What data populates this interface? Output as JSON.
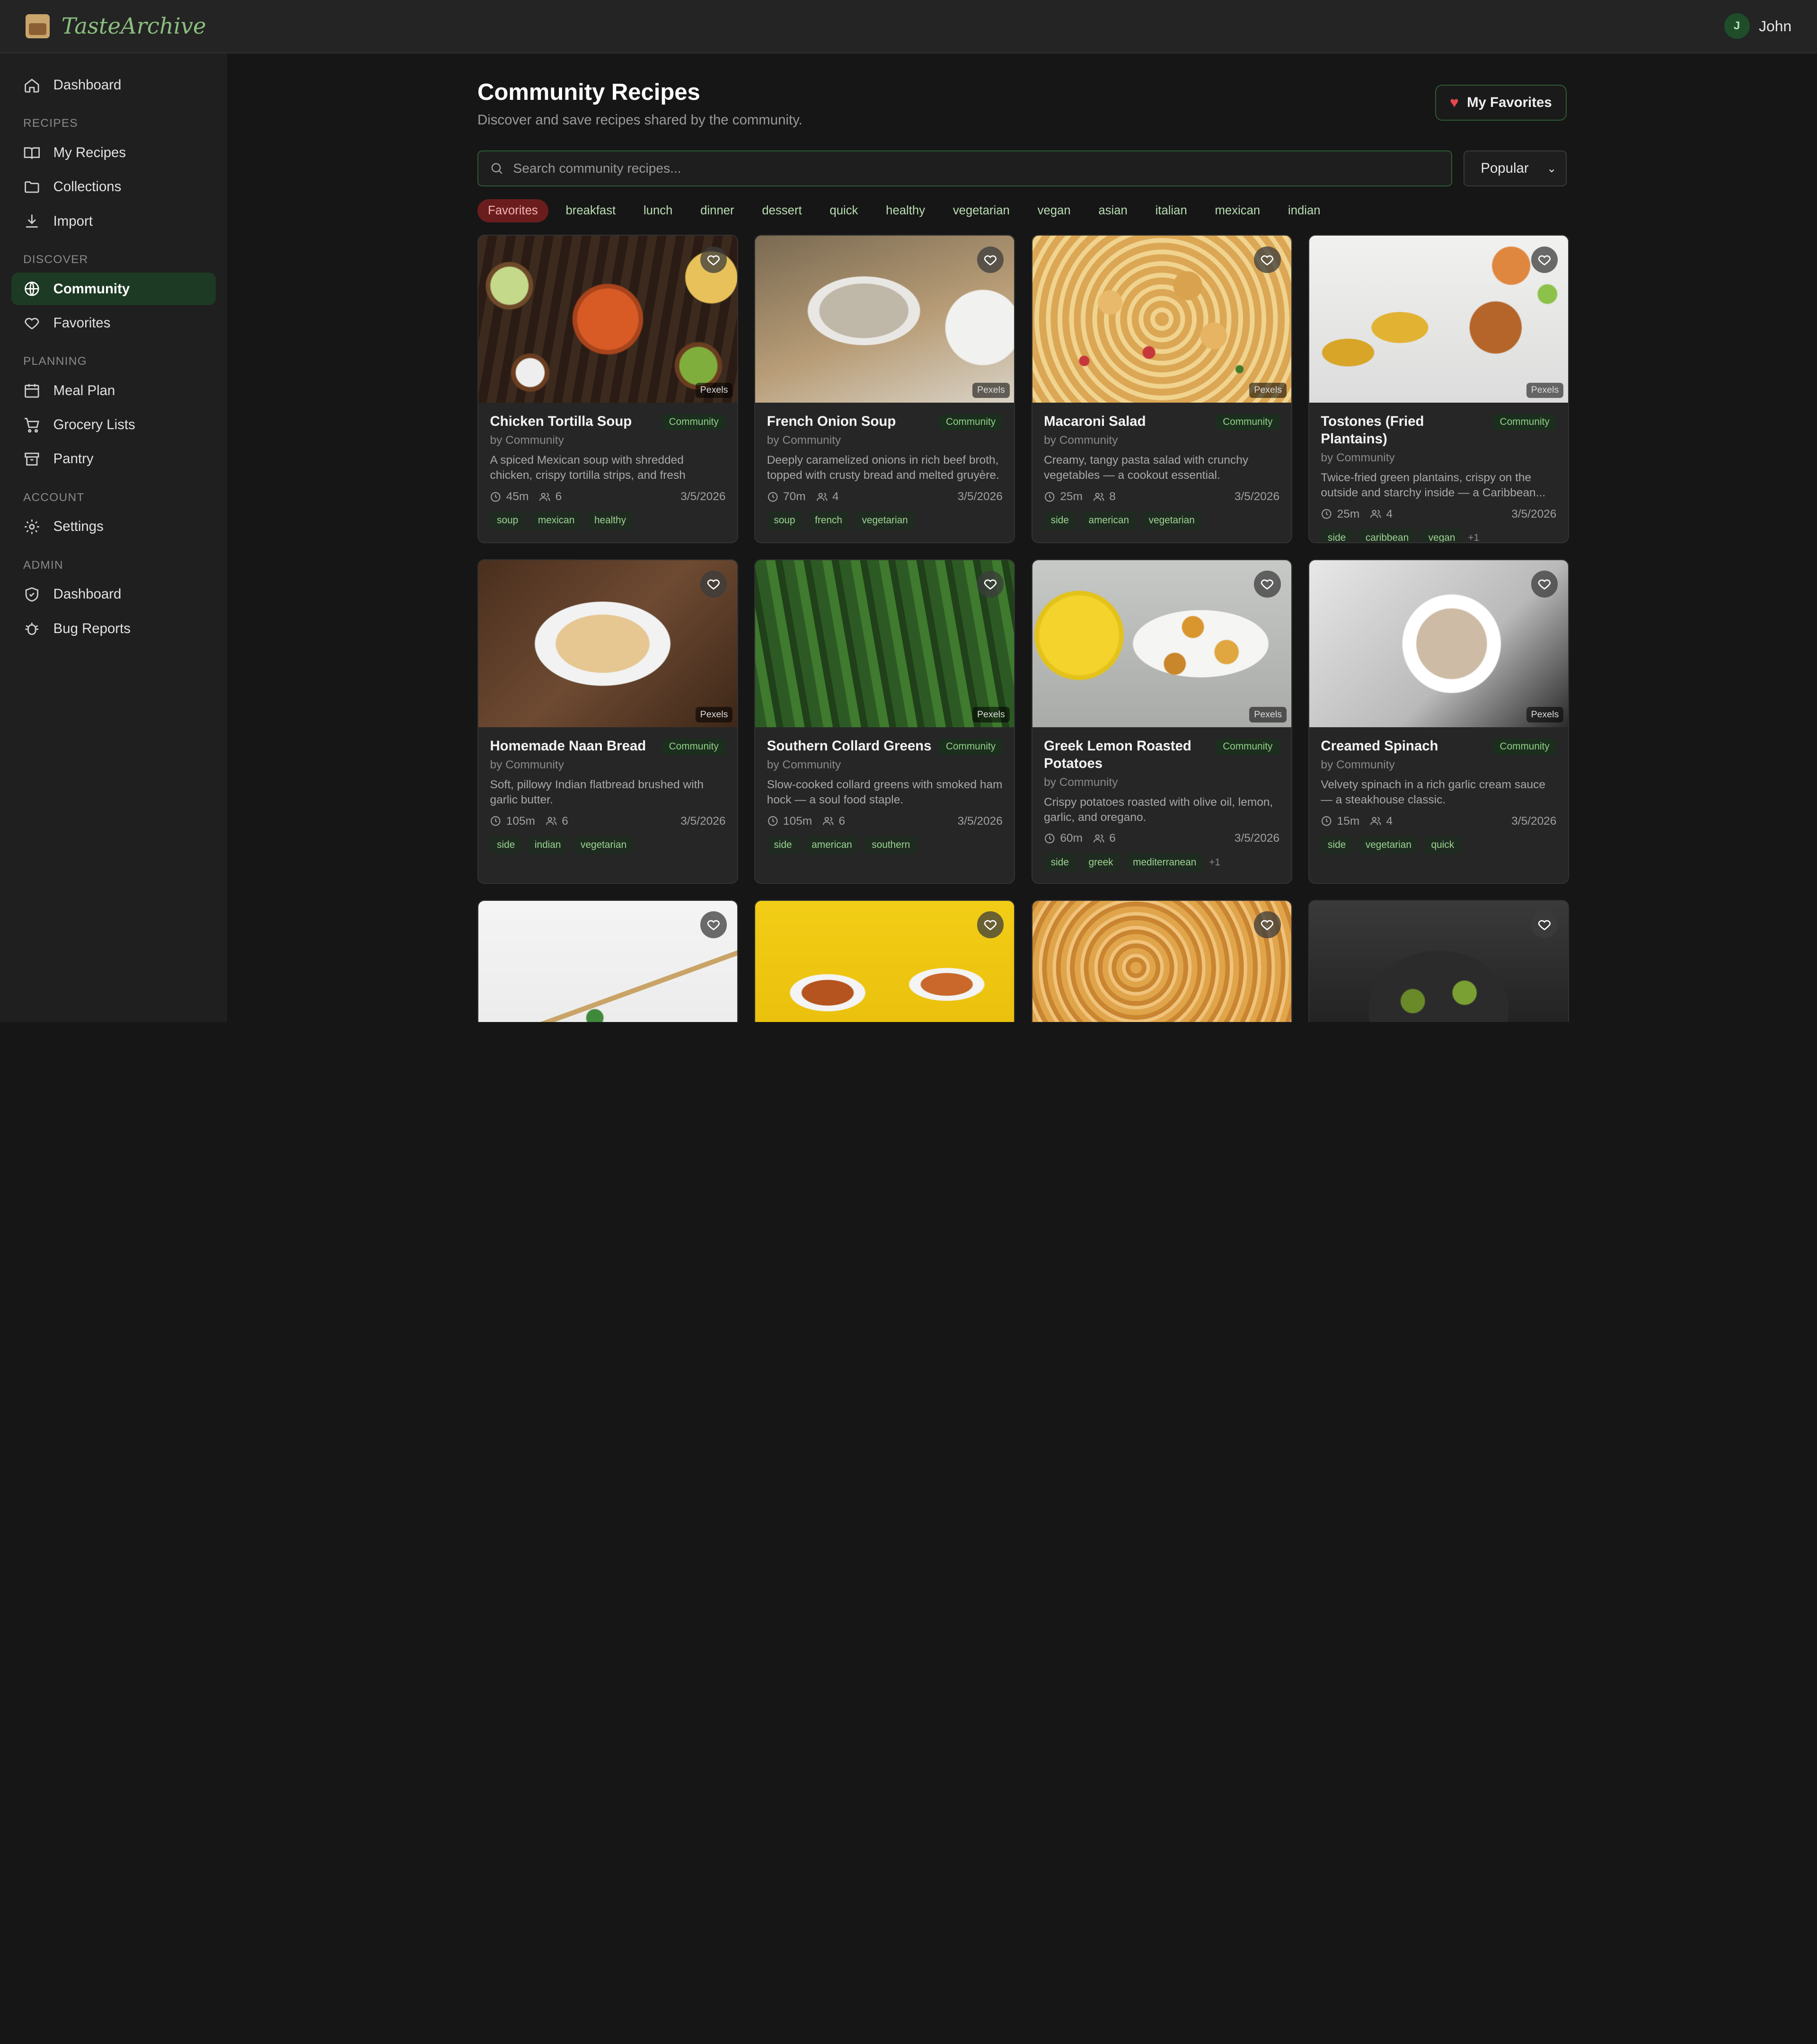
{
  "app": {
    "name": "TasteArchive"
  },
  "user": {
    "name": "John",
    "initial": "J"
  },
  "sidebar": {
    "top": {
      "label": "Dashboard",
      "icon": "home-icon"
    },
    "sections": [
      {
        "label": "RECIPES",
        "items": [
          {
            "label": "My Recipes",
            "icon": "book-icon"
          },
          {
            "label": "Collections",
            "icon": "folder-icon"
          },
          {
            "label": "Import",
            "icon": "download-icon"
          }
        ]
      },
      {
        "label": "DISCOVER",
        "items": [
          {
            "label": "Community",
            "icon": "globe-icon",
            "active": true
          },
          {
            "label": "Favorites",
            "icon": "heart-icon"
          }
        ]
      },
      {
        "label": "PLANNING",
        "items": [
          {
            "label": "Meal Plan",
            "icon": "calendar-icon"
          },
          {
            "label": "Grocery Lists",
            "icon": "cart-icon"
          },
          {
            "label": "Pantry",
            "icon": "archive-icon"
          }
        ]
      },
      {
        "label": "ACCOUNT",
        "items": [
          {
            "label": "Settings",
            "icon": "gear-icon"
          }
        ]
      },
      {
        "label": "ADMIN",
        "items": [
          {
            "label": "Dashboard",
            "icon": "shield-icon"
          },
          {
            "label": "Bug Reports",
            "icon": "bug-icon"
          }
        ]
      }
    ]
  },
  "page": {
    "title": "Community Recipes",
    "subtitle": "Discover and save recipes shared by the community.",
    "favorites_button": "My Favorites",
    "search_placeholder": "Search community recipes...",
    "sort_value": "Popular"
  },
  "filters": [
    "Favorites",
    "breakfast",
    "lunch",
    "dinner",
    "dessert",
    "quick",
    "healthy",
    "vegetarian",
    "vegan",
    "asian",
    "italian",
    "mexican",
    "indian"
  ],
  "image_credit": "Pexels",
  "badge": "Community",
  "recipes": [
    {
      "title": "Chicken Tortilla Soup",
      "author": "by Community",
      "desc": "A spiced Mexican soup with shredded chicken, crispy tortilla strips, and fresh toppings.",
      "time": "45m",
      "servings": "6",
      "date": "3/5/2026",
      "tags": [
        "soup",
        "mexican",
        "healthy"
      ],
      "more": ""
    },
    {
      "title": "French Onion Soup",
      "author": "by Community",
      "desc": "Deeply caramelized onions in rich beef broth, topped with crusty bread and melted gruyère.",
      "time": "70m",
      "servings": "4",
      "date": "3/5/2026",
      "tags": [
        "soup",
        "french",
        "vegetarian"
      ],
      "more": ""
    },
    {
      "title": "Macaroni Salad",
      "author": "by Community",
      "desc": "Creamy, tangy pasta salad with crunchy vegetables — a cookout essential.",
      "time": "25m",
      "servings": "8",
      "date": "3/5/2026",
      "tags": [
        "side",
        "american",
        "vegetarian"
      ],
      "more": ""
    },
    {
      "title": "Tostones (Fried Plantains)",
      "author": "by Community",
      "desc": "Twice-fried green plantains, crispy on the outside and starchy inside — a Caribbean...",
      "time": "25m",
      "servings": "4",
      "date": "3/5/2026",
      "tags": [
        "side",
        "caribbean",
        "vegan"
      ],
      "more": "+1"
    },
    {
      "title": "Homemade Naan Bread",
      "author": "by Community",
      "desc": "Soft, pillowy Indian flatbread brushed with garlic butter.",
      "time": "105m",
      "servings": "6",
      "date": "3/5/2026",
      "tags": [
        "side",
        "indian",
        "vegetarian"
      ],
      "more": ""
    },
    {
      "title": "Southern Collard Greens",
      "author": "by Community",
      "desc": "Slow-cooked collard greens with smoked ham hock — a soul food staple.",
      "time": "105m",
      "servings": "6",
      "date": "3/5/2026",
      "tags": [
        "side",
        "american",
        "southern"
      ],
      "more": ""
    },
    {
      "title": "Greek Lemon Roasted Potatoes",
      "author": "by Community",
      "desc": "Crispy potatoes roasted with olive oil, lemon, garlic, and oregano.",
      "time": "60m",
      "servings": "6",
      "date": "3/5/2026",
      "tags": [
        "side",
        "greek",
        "mediterranean"
      ],
      "more": "+1"
    },
    {
      "title": "Creamed Spinach",
      "author": "by Community",
      "desc": "Velvety spinach in a rich garlic cream sauce — a steakhouse classic.",
      "time": "15m",
      "servings": "4",
      "date": "3/5/2026",
      "tags": [
        "side",
        "vegetarian",
        "quick"
      ],
      "more": ""
    }
  ]
}
